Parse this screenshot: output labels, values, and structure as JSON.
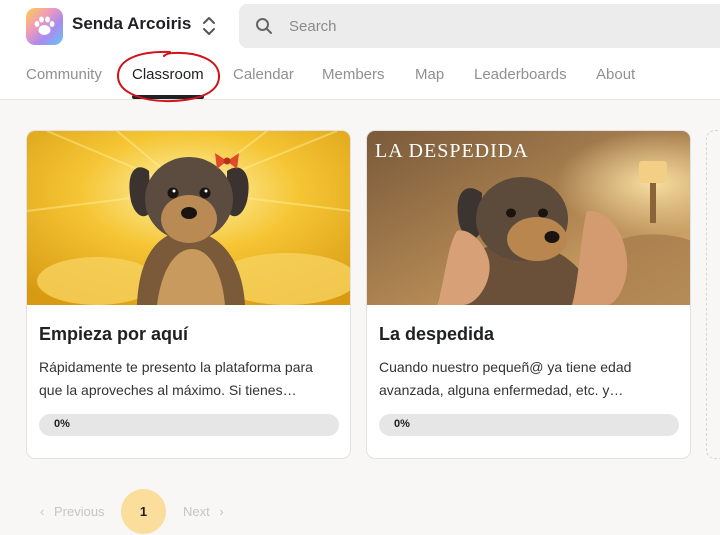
{
  "app": {
    "name": "Senda Arcoiris"
  },
  "search": {
    "placeholder": "Search"
  },
  "nav": {
    "tabs": [
      "Community",
      "Classroom",
      "Calendar",
      "Members",
      "Map",
      "Leaderboards",
      "About"
    ],
    "active": "Classroom"
  },
  "courses": [
    {
      "title": "Empieza por aquí",
      "description": "Rápidamente te presento la plataforma para que la aproveches al máximo. Si tienes…",
      "progress_label": "0%",
      "progress": 0,
      "image": {
        "kind": "yorkie-dog-with-red-bow-golden-background"
      }
    },
    {
      "title": "La despedida",
      "description": "Cuando nuestro pequeñ@ ya tiene edad avanzada, alguna enfermedad, etc. y…",
      "progress_label": "0%",
      "progress": 0,
      "image": {
        "kind": "yorkie-dog-held-by-hands",
        "overlay_text": "LA DESPEDIDA"
      }
    }
  ],
  "pagination": {
    "previous": "Previous",
    "current": "1",
    "next": "Next"
  },
  "colors": {
    "accent": "#fbdd9c",
    "annotation": "#d0121b"
  }
}
